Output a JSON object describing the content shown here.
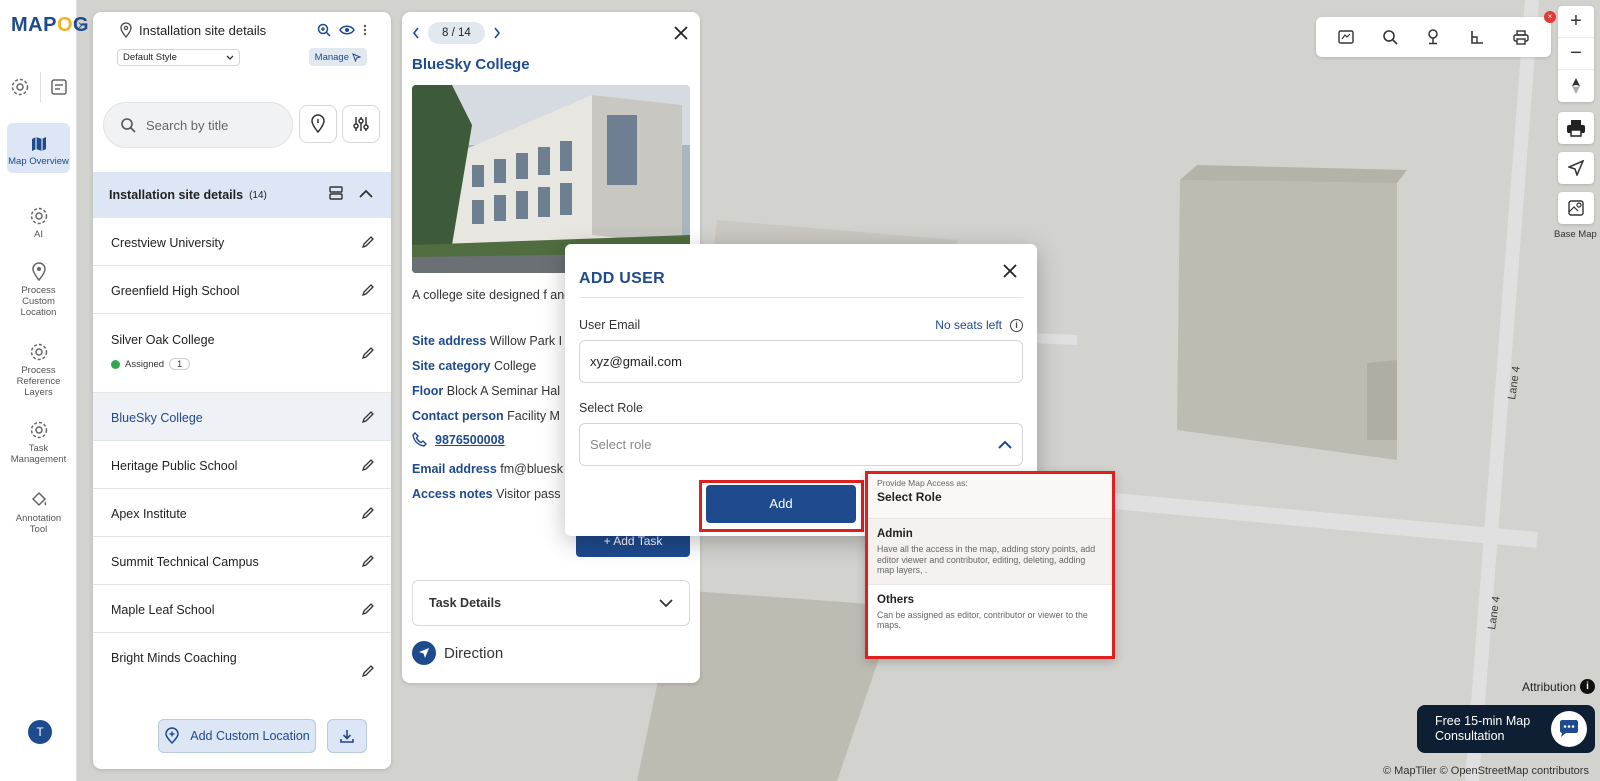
{
  "brand": {
    "logo_left": "MAP",
    "logo_o": "O",
    "logo_right": "G"
  },
  "rail": {
    "items": [
      {
        "label": "Map Overview",
        "icon": "map-icon"
      },
      {
        "label": "AI",
        "icon": "gear-icon"
      },
      {
        "label": "Process Custom Location",
        "icon": "location-pin-icon"
      },
      {
        "label": "Process Reference Layers",
        "icon": "gear-icon"
      },
      {
        "label": "Task Management",
        "icon": "gear-icon"
      },
      {
        "label": "Annotation Tool",
        "icon": "paint-bucket-icon"
      }
    ],
    "avatar_initial": "T"
  },
  "list_panel": {
    "header_title": "Installation site details",
    "style_select": "Default Style",
    "manage_label": "Manage",
    "search_placeholder": "Search by title",
    "group_title": "Installation site details",
    "group_count": "(14)",
    "items": [
      {
        "label": "Crestview University"
      },
      {
        "label": "Greenfield High School"
      },
      {
        "label": "Silver Oak College",
        "status": "Assigned",
        "status_count": "1"
      },
      {
        "label": "BlueSky College",
        "selected": true
      },
      {
        "label": "Heritage Public School"
      },
      {
        "label": "Apex Institute"
      },
      {
        "label": "Summit Technical Campus"
      },
      {
        "label": "Maple Leaf School"
      },
      {
        "label": "Bright Minds Coaching"
      }
    ],
    "add_custom_label": "Add Custom Location"
  },
  "detail": {
    "pager": "8 / 14",
    "title": "BlueSky College",
    "description": "A college site designed f and institutional projects.",
    "fields": [
      {
        "key": "Site address",
        "value": "Willow Park I"
      },
      {
        "key": "Site category",
        "value": "College"
      },
      {
        "key": "Floor",
        "value": "Block A Seminar Hal"
      },
      {
        "key": "Contact person",
        "value": "Facility M"
      }
    ],
    "phone": "9876500008",
    "fields2": [
      {
        "key": "Email address",
        "value": "fm@bluesk"
      },
      {
        "key": "Access notes",
        "value": "Visitor pass"
      }
    ],
    "add_task_label": "+ Add Task",
    "task_details_label": "Task Details",
    "direction_label": "Direction"
  },
  "modal": {
    "title": "ADD USER",
    "email_label": "User Email",
    "seats_text": "No seats left",
    "email_value": "xyz@gmail.com",
    "role_label": "Select Role",
    "role_placeholder": "Select role",
    "add_label": "Add"
  },
  "role_dropdown": {
    "subtitle": "Provide Map Access as:",
    "title": "Select Role",
    "options": [
      {
        "name": "Admin",
        "desc": "Have all the access in the map, adding story points, add editor viewer and contributor, editing, deleting, adding map layers, ."
      },
      {
        "name": "Others",
        "desc": "Can be assigned as editor, contributor or viewer to the maps."
      }
    ]
  },
  "map": {
    "base_map_label": "Base Map",
    "road_labels": [
      "Lane 4",
      "Lane 4"
    ],
    "attribution_label": "Attribution",
    "consult_line1": "Free 15-min Map",
    "consult_line2": "Consultation",
    "copyright": "© MapTiler © OpenStreetMap contributors"
  },
  "colors": {
    "accent": "#1e4a8e",
    "highlight_red": "#e02020",
    "assigned_green": "#2fa84f"
  }
}
